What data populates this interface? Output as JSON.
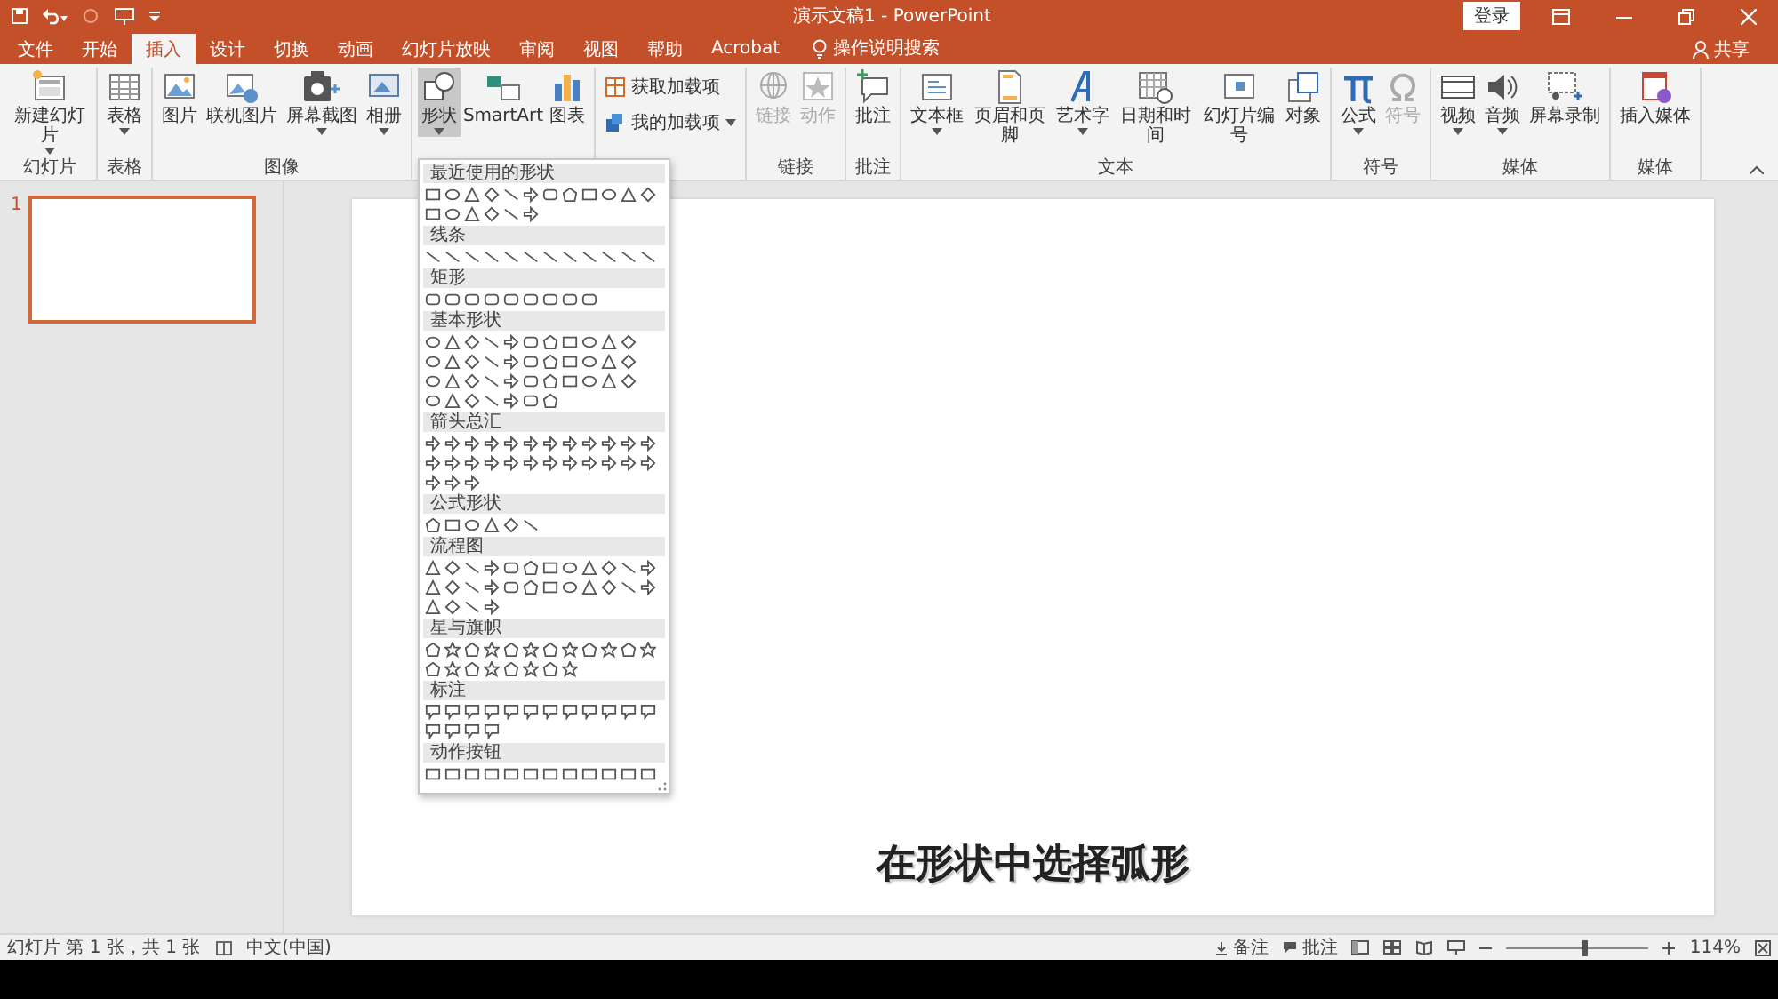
{
  "window": {
    "title": "演示文稿1  -  PowerPoint",
    "sign_in": "登录",
    "share": "共享"
  },
  "tabs": [
    {
      "label": "文件",
      "selected": false
    },
    {
      "label": "开始",
      "selected": false
    },
    {
      "label": "插入",
      "selected": true
    },
    {
      "label": "设计",
      "selected": false
    },
    {
      "label": "切换",
      "selected": false
    },
    {
      "label": "动画",
      "selected": false
    },
    {
      "label": "幻灯片放映",
      "selected": false
    },
    {
      "label": "审阅",
      "selected": false
    },
    {
      "label": "视图",
      "selected": false
    },
    {
      "label": "帮助",
      "selected": false
    },
    {
      "label": "Acrobat",
      "selected": false
    }
  ],
  "search": {
    "placeholder": "操作说明搜索"
  },
  "ribbon": {
    "groups": [
      {
        "label": "幻灯片",
        "buttons": [
          {
            "kind": "large",
            "label": "新建幻灯片",
            "dropdown": true,
            "disabled": false,
            "selected": false
          }
        ]
      },
      {
        "label": "表格",
        "buttons": [
          {
            "kind": "large",
            "label": "表格",
            "dropdown": true,
            "disabled": false,
            "selected": false
          }
        ]
      },
      {
        "label": "图像",
        "buttons": [
          {
            "kind": "large",
            "label": "图片",
            "dropdown": false,
            "disabled": false,
            "selected": false
          },
          {
            "kind": "large",
            "label": "联机图片",
            "dropdown": false,
            "disabled": false,
            "selected": false
          },
          {
            "kind": "large",
            "label": "屏幕截图",
            "dropdown": true,
            "disabled": false,
            "selected": false
          },
          {
            "kind": "large",
            "label": "相册",
            "dropdown": true,
            "disabled": false,
            "selected": false
          }
        ]
      },
      {
        "buttons": [
          {
            "kind": "large",
            "label": "形状",
            "dropdown": true,
            "disabled": false,
            "selected": true
          },
          {
            "kind": "large",
            "label": "SmartArt",
            "dropdown": false,
            "disabled": false,
            "selected": false
          },
          {
            "kind": "large",
            "label": "图表",
            "dropdown": false,
            "disabled": false,
            "selected": false
          }
        ]
      },
      {
        "buttons": [
          {
            "kind": "small",
            "label": "获取加载项",
            "dropdown": false,
            "disabled": false,
            "selected": false
          },
          {
            "kind": "small",
            "label": "我的加载项",
            "dropdown": true,
            "disabled": false,
            "selected": false
          }
        ]
      },
      {
        "label": "链接",
        "buttons": [
          {
            "kind": "large",
            "label": "链接",
            "dropdown": false,
            "disabled": true,
            "selected": false
          },
          {
            "kind": "large",
            "label": "动作",
            "dropdown": false,
            "disabled": true,
            "selected": false
          }
        ]
      },
      {
        "label": "批注",
        "buttons": [
          {
            "kind": "large",
            "label": "批注",
            "dropdown": false,
            "disabled": false,
            "selected": false
          }
        ]
      },
      {
        "label": "文本",
        "buttons": [
          {
            "kind": "large",
            "label": "文本框",
            "dropdown": true,
            "disabled": false,
            "selected": false
          },
          {
            "kind": "large",
            "label": "页眉和页脚",
            "dropdown": false,
            "disabled": false,
            "selected": false
          },
          {
            "kind": "large",
            "label": "艺术字",
            "dropdown": true,
            "disabled": false,
            "selected": false
          },
          {
            "kind": "large",
            "label": "日期和时间",
            "dropdown": false,
            "disabled": false,
            "selected": false
          },
          {
            "kind": "large",
            "label": "幻灯片编号",
            "dropdown": false,
            "disabled": false,
            "selected": false
          },
          {
            "kind": "large",
            "label": "对象",
            "dropdown": false,
            "disabled": false,
            "selected": false
          }
        ]
      },
      {
        "label": "符号",
        "buttons": [
          {
            "kind": "large",
            "label": "公式",
            "dropdown": true,
            "disabled": false,
            "selected": false
          },
          {
            "kind": "large",
            "label": "符号",
            "dropdown": false,
            "disabled": true,
            "selected": false
          }
        ]
      },
      {
        "label": "媒体",
        "buttons": [
          {
            "kind": "large",
            "label": "视频",
            "dropdown": true,
            "disabled": false,
            "selected": false
          },
          {
            "kind": "large",
            "label": "音频",
            "dropdown": true,
            "disabled": false,
            "selected": false
          },
          {
            "kind": "large",
            "label": "屏幕录制",
            "dropdown": false,
            "disabled": false,
            "selected": false
          }
        ]
      },
      {
        "label": "媒体",
        "buttons": [
          {
            "kind": "large",
            "label": "插入媒体",
            "dropdown": false,
            "disabled": false,
            "selected": false
          }
        ]
      }
    ]
  },
  "shapes_menu": {
    "sections": [
      {
        "title": "最近使用的形状"
      },
      {
        "title": "线条"
      },
      {
        "title": "矩形"
      },
      {
        "title": "基本形状"
      },
      {
        "title": "箭头总汇"
      },
      {
        "title": "公式形状"
      },
      {
        "title": "流程图"
      },
      {
        "title": "星与旗帜"
      },
      {
        "title": "标注"
      },
      {
        "title": "动作按钮"
      }
    ]
  },
  "slides": [
    {
      "number": "1",
      "selected": true
    }
  ],
  "caption": "在形状中选择弧形",
  "status_bar": {
    "slide_info": "幻灯片 第 1 张，共 1 张",
    "language": "中文(中国)",
    "notes": "备注",
    "comments": "批注",
    "zoom": {
      "level": 0.55,
      "reading": "114%"
    }
  }
}
